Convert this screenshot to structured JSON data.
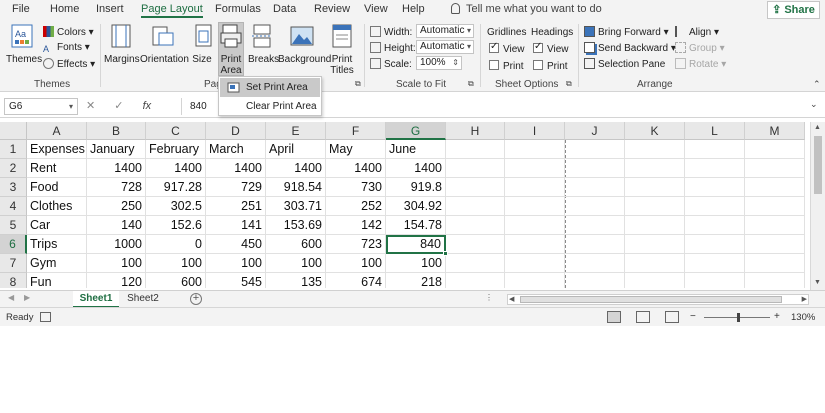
{
  "tabs": [
    "File",
    "Home",
    "Insert",
    "Page Layout",
    "Formulas",
    "Data",
    "Review",
    "View",
    "Help"
  ],
  "active_tab": "Page Layout",
  "tell_me": "Tell me what you want to do",
  "share": "Share",
  "ribbon": {
    "themes": {
      "themes_label": "Themes",
      "colors": "Colors",
      "fonts": "Fonts",
      "effects": "Effects",
      "group": "Themes"
    },
    "page_setup": {
      "margins": "Margins",
      "orientation": "Orientation",
      "size": "Size",
      "print_area_1": "Print",
      "print_area_2": "Area",
      "breaks": "Breaks",
      "background": "Background",
      "print_titles_1": "Print",
      "print_titles_2": "Titles",
      "group": "Pag"
    },
    "scale": {
      "width_label": "Width:",
      "width_value": "Automatic",
      "height_label": "Height:",
      "height_value": "Automatic",
      "scale_label": "Scale:",
      "scale_value": "100%",
      "group": "Scale to Fit"
    },
    "sheet_options": {
      "gridlines": "Gridlines",
      "headings": "Headings",
      "view": "View",
      "print": "Print",
      "group": "Sheet Options"
    },
    "arrange": {
      "bring_forward": "Bring Forward",
      "send_backward": "Send Backward",
      "selection_pane": "Selection Pane",
      "align": "Align",
      "group_btn": "Group",
      "rotate": "Rotate",
      "group": "Arrange"
    }
  },
  "dropdown": {
    "set_print_area": "Set Print Area",
    "clear_print_area": "Clear Print Area"
  },
  "formula_bar": {
    "name_box": "G6",
    "cancel": "✕",
    "enter": "✓",
    "fx": "fx",
    "value": "840"
  },
  "columns": [
    "A",
    "B",
    "C",
    "D",
    "E",
    "F",
    "G",
    "H",
    "I",
    "J",
    "K",
    "L",
    "M"
  ],
  "rows": [
    "1",
    "2",
    "3",
    "4",
    "5",
    "6",
    "7",
    "8"
  ],
  "cells": [
    [
      "Expenses",
      "January",
      "February",
      "March",
      "April",
      "May",
      "June"
    ],
    [
      "Rent",
      "1400",
      "1400",
      "1400",
      "1400",
      "1400",
      "1400"
    ],
    [
      "Food",
      "728",
      "917.28",
      "729",
      "918.54",
      "730",
      "919.8"
    ],
    [
      "Clothes",
      "250",
      "302.5",
      "251",
      "303.71",
      "252",
      "304.92"
    ],
    [
      "Car",
      "140",
      "152.6",
      "141",
      "153.69",
      "142",
      "154.78"
    ],
    [
      "Trips",
      "1000",
      "0",
      "450",
      "600",
      "723",
      "840"
    ],
    [
      "Gym",
      "100",
      "100",
      "100",
      "100",
      "100",
      "100"
    ],
    [
      "Fun",
      "120",
      "600",
      "545",
      "135",
      "674",
      "218"
    ]
  ],
  "sheets": [
    "Sheet1",
    "Sheet2"
  ],
  "active_sheet": "Sheet1",
  "status": {
    "ready": "Ready",
    "zoom": "130%",
    "zoom_out": "−",
    "zoom_in": "+"
  },
  "colors": {
    "accent": "#217346",
    "ribbon_bg": "#f3f3f3",
    "header_bg": "#e8e8e8"
  }
}
